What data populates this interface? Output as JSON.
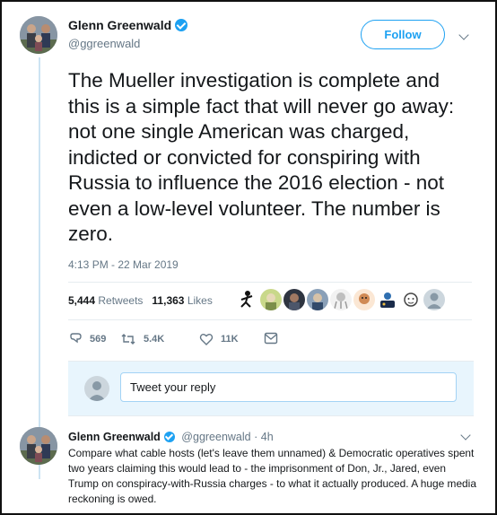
{
  "tweet": {
    "author_name": "Glenn Greenwald",
    "author_handle": "@ggreenwald",
    "follow_label": "Follow",
    "text": "The Mueller investigation is complete and this is a simple fact that will never go away: not one single American was charged, indicted or convicted for conspiring with Russia to influence the 2016 election - not even a low-level volunteer. The number is zero.",
    "timestamp": "4:13 PM - 22 Mar 2019",
    "retweets_count": "5,444",
    "retweets_label": "Retweets",
    "likes_count": "11,363",
    "likes_label": "Likes",
    "likers_count": 10,
    "actions": {
      "replies": "569",
      "retweets": "5.4K",
      "likes": "11K"
    }
  },
  "reply_box": {
    "placeholder": "Tweet your reply"
  },
  "reply": {
    "author_name": "Glenn Greenwald",
    "author_handle": "@ggreenwald",
    "time": "4h",
    "text": "Compare what cable hosts (let's leave them unnamed) & Democratic operatives spent two years claiming this would lead to - the imprisonment of Don, Jr., Jared, even Trump on conspiracy-with-Russia charges - to what it actually produced. A huge media reckoning is owed."
  },
  "colors": {
    "accent": "#1da1f2",
    "muted": "#657786",
    "text": "#14171a",
    "reply_bg": "#e8f5fd"
  },
  "icons": [
    "verified-badge-icon",
    "chevron-down-icon",
    "reply-icon",
    "retweet-icon",
    "heart-icon",
    "message-icon"
  ]
}
